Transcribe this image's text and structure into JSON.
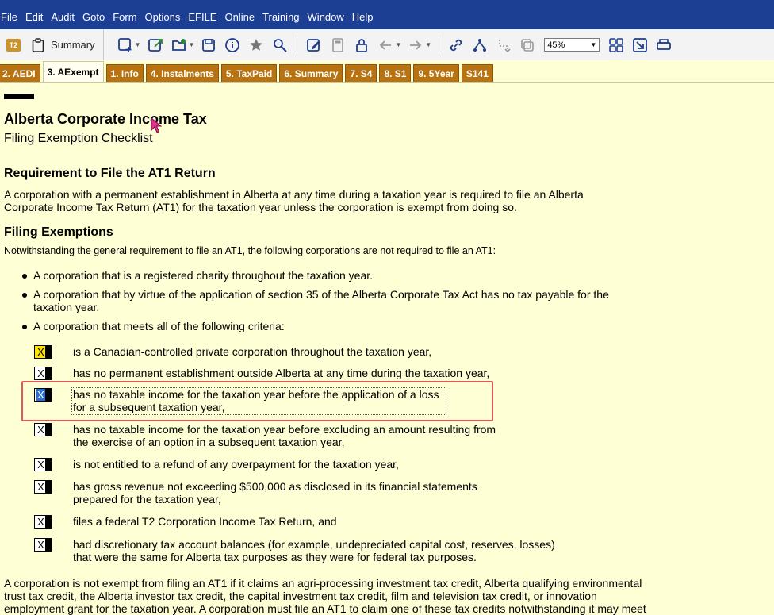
{
  "menu": [
    "File",
    "Edit",
    "Audit",
    "Goto",
    "Form",
    "Options",
    "EFILE",
    "Online",
    "Training",
    "Window",
    "Help"
  ],
  "toolbar": {
    "badge": "T2",
    "summary_label": "Summary",
    "zoom_value": "45%",
    "icons": [
      "new-form-icon",
      "export-icon",
      "open-folder-icon",
      "save-icon",
      "info-icon",
      "star-icon",
      "search-icon",
      "edit-icon",
      "calculator-icon",
      "lock-icon",
      "back-arrow-icon",
      "forward-arrow-icon",
      "link-icon",
      "tree-icon",
      "route-icon",
      "copy-icon",
      "grid-icon",
      "export-window-icon",
      "print-icon"
    ]
  },
  "tabs": [
    {
      "label": "2. AEDI",
      "active": false
    },
    {
      "label": "3. AExempt",
      "active": true
    },
    {
      "label": "1. Info",
      "active": false
    },
    {
      "label": "4. Instalments",
      "active": false
    },
    {
      "label": "5. TaxPaid",
      "active": false
    },
    {
      "label": "6. Summary",
      "active": false
    },
    {
      "label": "7. S4",
      "active": false
    },
    {
      "label": "8. S1",
      "active": false
    },
    {
      "label": "9. 5Year",
      "active": false
    },
    {
      "label": "S141",
      "active": false
    }
  ],
  "doc": {
    "title": "Alberta Corporate Income Tax",
    "subtitle": "Filing Exemption Checklist",
    "section1_heading": "Requirement to File the AT1 Return",
    "section1_line1": "A corporation with a permanent establishment in Alberta at any time during a taxation year is required to file an Alberta",
    "section1_line2": "Corporate Income Tax Return (AT1) for the taxation year unless the corporation is exempt from doing so.",
    "section2_heading": "Filing Exemptions",
    "section2_intro": "Notwithstanding the general requirement to file an AT1, the following corporations are not required to file an AT1:",
    "bullets": [
      {
        "lines": [
          "A corporation that is a registered charity throughout the taxation year."
        ]
      },
      {
        "lines": [
          "A corporation that by virtue of the application of section 35 of the Alberta Corporate Tax Act has no tax payable for the",
          "taxation year."
        ]
      },
      {
        "lines": [
          "A corporation that meets all of the following criteria:"
        ]
      }
    ],
    "criteria": [
      {
        "mark": "X",
        "state": "yellow",
        "line1": "is a Canadian-controlled private corporation throughout the taxation year,",
        "line2": ""
      },
      {
        "mark": "X",
        "state": "normal",
        "line1": "has no permanent establishment outside Alberta at any time during the taxation year,",
        "line2": ""
      },
      {
        "mark": "X",
        "state": "selected",
        "line1": "has no taxable income for the taxation year before the application of a loss",
        "line2": "for a subsequent taxation year,"
      },
      {
        "mark": "X",
        "state": "normal",
        "line1": "has no taxable income for the taxation year before excluding an amount resulting from",
        "line2": "the exercise of an option in a subsequent taxation year,"
      },
      {
        "mark": "X",
        "state": "normal",
        "line1": "is not entitled to a refund of any overpayment for the taxation year,",
        "line2": ""
      },
      {
        "mark": "X",
        "state": "normal",
        "line1": "has gross revenue not exceeding $500,000 as disclosed in its financial statements",
        "line2": "prepared for the taxation year,"
      },
      {
        "mark": "X",
        "state": "normal",
        "line1": "files a federal T2 Corporation Income Tax Return, and",
        "line2": ""
      },
      {
        "mark": "X",
        "state": "normal",
        "line1": "had discretionary tax account balances (for example, undepreciated capital cost, reserves, losses)",
        "line2": "that were the same for Alberta tax purposes as they were for federal tax purposes."
      }
    ],
    "footer_line1": "A corporation is not exempt from filing an AT1 if it claims an agri-processing investment tax credit, Alberta qualifying environmental",
    "footer_line2": "trust tax credit, the Alberta investor tax credit, the capital investment tax credit, film and television tax credit, or innovation",
    "footer_line3": "employment grant for the taxation year. A corporation must file an AT1 to claim one of these tax credits notwithstanding it may meet"
  },
  "colors": {
    "menubar": "#1c3f94",
    "page_bg": "#ffffd6",
    "tab_bg": "#b8720f",
    "highlight": "#e25757",
    "selected_cell": "#2a6fd3"
  }
}
